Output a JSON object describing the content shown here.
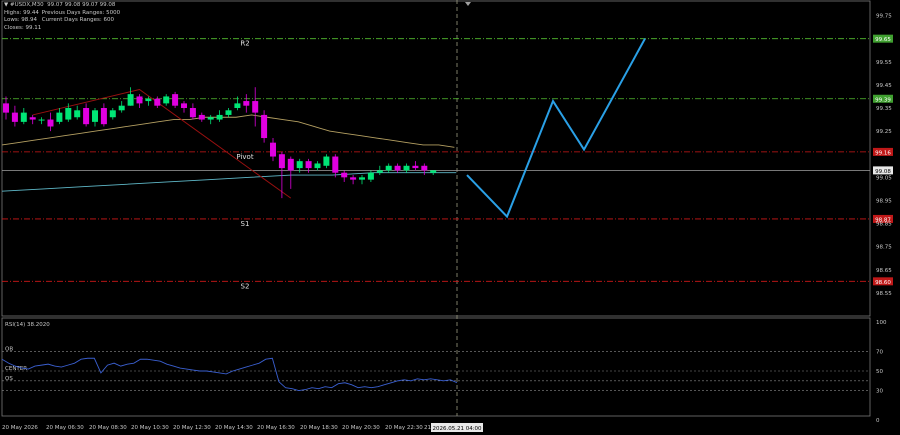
{
  "header": {
    "symbol_line": "▼ #USDX,M30  99.07 99.08 99.07 99.08",
    "highs": "Highs: 99.44",
    "highs_note": "Previous Days Ranges: 5000",
    "lows": "Lows: 98.94",
    "lows_note": "Current Days Ranges: 600",
    "closes": "Closes: 99.11"
  },
  "colors": {
    "background": "#000000",
    "bull": "#00e676",
    "bear": "#e000e0",
    "forecast": "#2aa0e6",
    "ma_slow": "#b5a062",
    "ma_fast": "#5fb8c8",
    "trend_red": "#9a1010",
    "resistance": "#55c030",
    "support": "#d01818",
    "rsi_line": "#3a5fd0",
    "axis_text": "#c8c8c8"
  },
  "chart_data": [
    {
      "type": "candlestick",
      "symbol": "#USDX",
      "timeframe": "M30",
      "ylim": [
        98.45,
        99.8
      ],
      "price_ticks": [
        "99.75",
        "99.65",
        "99.55",
        "99.45",
        "99.39",
        "99.35",
        "99.25",
        "99.16",
        "99.08",
        "99.05",
        "98.95",
        "98.85",
        "98.75",
        "98.65",
        "98.55"
      ],
      "time_labels": [
        "20 May 2026",
        "20 May 06:30",
        "20 May 08:30",
        "20 May 10:30",
        "20 May 12:30",
        "20 May 14:30",
        "20 May 16:30",
        "20 May 18:30",
        "20 May 20:30",
        "20 May 22:30",
        "21"
      ],
      "current_time_label": "2026.05.21 04:00",
      "current_price": "99.08",
      "candles": [
        {
          "o": 99.37,
          "h": 99.4,
          "c": 99.33,
          "l": 99.3
        },
        {
          "o": 99.33,
          "h": 99.36,
          "c": 99.29,
          "l": 99.27
        },
        {
          "o": 99.29,
          "h": 99.35,
          "c": 99.33,
          "l": 99.28
        },
        {
          "o": 99.31,
          "h": 99.32,
          "c": 99.3,
          "l": 99.28
        },
        {
          "o": 99.3,
          "h": 99.31,
          "c": 99.3,
          "l": 99.28
        },
        {
          "o": 99.3,
          "h": 99.33,
          "c": 99.27,
          "l": 99.25
        },
        {
          "o": 99.29,
          "h": 99.35,
          "c": 99.33,
          "l": 99.28
        },
        {
          "o": 99.3,
          "h": 99.37,
          "c": 99.35,
          "l": 99.29
        },
        {
          "o": 99.31,
          "h": 99.36,
          "c": 99.34,
          "l": 99.3
        },
        {
          "o": 99.35,
          "h": 99.37,
          "c": 99.28,
          "l": 99.27
        },
        {
          "o": 99.29,
          "h": 99.35,
          "c": 99.34,
          "l": 99.27
        },
        {
          "o": 99.35,
          "h": 99.37,
          "c": 99.28,
          "l": 99.27
        },
        {
          "o": 99.31,
          "h": 99.35,
          "c": 99.34,
          "l": 99.3
        },
        {
          "o": 99.34,
          "h": 99.38,
          "c": 99.36,
          "l": 99.33
        },
        {
          "o": 99.36,
          "h": 99.44,
          "c": 99.41,
          "l": 99.36
        },
        {
          "o": 99.4,
          "h": 99.41,
          "c": 99.37,
          "l": 99.35
        },
        {
          "o": 99.38,
          "h": 99.4,
          "c": 99.39,
          "l": 99.36
        },
        {
          "o": 99.39,
          "h": 99.4,
          "c": 99.36,
          "l": 99.35
        },
        {
          "o": 99.37,
          "h": 99.41,
          "c": 99.4,
          "l": 99.36
        },
        {
          "o": 99.41,
          "h": 99.42,
          "c": 99.36,
          "l": 99.35
        },
        {
          "o": 99.37,
          "h": 99.38,
          "c": 99.35,
          "l": 99.33
        },
        {
          "o": 99.35,
          "h": 99.37,
          "c": 99.31,
          "l": 99.3
        },
        {
          "o": 99.32,
          "h": 99.33,
          "c": 99.3,
          "l": 99.29
        },
        {
          "o": 99.3,
          "h": 99.32,
          "c": 99.31,
          "l": 99.28
        },
        {
          "o": 99.3,
          "h": 99.34,
          "c": 99.32,
          "l": 99.29
        },
        {
          "o": 99.32,
          "h": 99.35,
          "c": 99.34,
          "l": 99.31
        },
        {
          "o": 99.35,
          "h": 99.4,
          "c": 99.37,
          "l": 99.34
        },
        {
          "o": 99.38,
          "h": 99.41,
          "c": 99.36,
          "l": 99.33
        },
        {
          "o": 99.38,
          "h": 99.44,
          "c": 99.33,
          "l": 99.27
        },
        {
          "o": 99.32,
          "h": 99.34,
          "c": 99.22,
          "l": 99.2
        },
        {
          "o": 99.2,
          "h": 99.22,
          "c": 99.14,
          "l": 99.12
        },
        {
          "o": 99.15,
          "h": 99.16,
          "c": 99.09,
          "l": 98.96
        },
        {
          "o": 99.13,
          "h": 99.14,
          "c": 99.08,
          "l": 99.0
        },
        {
          "o": 99.09,
          "h": 99.13,
          "c": 99.12,
          "l": 99.07
        },
        {
          "o": 99.12,
          "h": 99.13,
          "c": 99.09,
          "l": 99.07
        },
        {
          "o": 99.09,
          "h": 99.12,
          "c": 99.11,
          "l": 99.08
        },
        {
          "o": 99.1,
          "h": 99.15,
          "c": 99.14,
          "l": 99.09
        },
        {
          "o": 99.14,
          "h": 99.15,
          "c": 99.07,
          "l": 99.05
        },
        {
          "o": 99.07,
          "h": 99.08,
          "c": 99.05,
          "l": 99.03
        },
        {
          "o": 99.05,
          "h": 99.06,
          "c": 99.04,
          "l": 99.02
        },
        {
          "o": 99.04,
          "h": 99.06,
          "c": 99.05,
          "l": 99.02
        },
        {
          "o": 99.04,
          "h": 99.08,
          "c": 99.07,
          "l": 99.03
        },
        {
          "o": 99.07,
          "h": 99.1,
          "c": 99.08,
          "l": 99.06
        },
        {
          "o": 99.08,
          "h": 99.11,
          "c": 99.1,
          "l": 99.07
        },
        {
          "o": 99.1,
          "h": 99.11,
          "c": 99.08,
          "l": 99.07
        },
        {
          "o": 99.08,
          "h": 99.11,
          "c": 99.1,
          "l": 99.07
        },
        {
          "o": 99.1,
          "h": 99.12,
          "c": 99.09,
          "l": 99.08
        },
        {
          "o": 99.1,
          "h": 99.11,
          "c": 99.08,
          "l": 99.06
        },
        {
          "o": 99.07,
          "h": 99.08,
          "c": 99.08,
          "l": 99.06
        }
      ],
      "ma_slow": [
        99.19,
        99.2,
        99.21,
        99.22,
        99.23,
        99.24,
        99.25,
        99.26,
        99.27,
        99.28,
        99.29,
        99.3,
        99.3,
        99.31,
        99.31,
        99.31,
        99.32,
        99.31,
        99.3,
        99.29,
        99.27,
        99.25,
        99.24,
        99.23,
        99.22,
        99.21,
        99.2,
        99.19,
        99.19,
        99.18
      ],
      "ma_fast": [
        98.99,
        99.0,
        99.01,
        99.02,
        99.03,
        99.04,
        99.05,
        99.06,
        99.06,
        99.07,
        99.07,
        99.07
      ],
      "trend_line": [
        99.32,
        99.43,
        98.96
      ],
      "levels": [
        {
          "label": "R2",
          "value": 99.65,
          "price_tag": "99.65",
          "kind": "resistance"
        },
        {
          "label": "",
          "value": 99.39,
          "price_tag": "99.39",
          "kind": "resistance"
        },
        {
          "label": "Pivot",
          "value": 99.16,
          "price_tag": "99.16",
          "kind": "pivot"
        },
        {
          "label": "S1",
          "value": 98.87,
          "price_tag": "98.87",
          "kind": "support"
        },
        {
          "label": "S2",
          "value": 98.6,
          "price_tag": "98.60",
          "kind": "support"
        }
      ],
      "forecast_path": [
        99.06,
        98.88,
        99.38,
        99.17,
        99.65
      ]
    },
    {
      "type": "line",
      "title": "RSI(14) 38.2020",
      "ylim": [
        0,
        100
      ],
      "y_ticks": [
        "100",
        "70",
        "50",
        "30",
        "0"
      ],
      "levels": [
        {
          "label": "OB",
          "value": 70
        },
        {
          "label": "CENTER",
          "value": 50
        },
        {
          "label": "OS",
          "value": 40
        },
        {
          "label": "",
          "value": 30
        }
      ],
      "values": [
        62,
        58,
        55,
        53,
        52,
        55,
        56,
        57,
        55,
        54,
        56,
        58,
        62,
        63,
        63,
        48,
        56,
        58,
        55,
        57,
        58,
        62,
        62,
        61,
        60,
        57,
        55,
        53,
        52,
        51,
        50,
        50,
        49,
        48,
        47,
        50,
        52,
        54,
        56,
        58,
        62,
        63,
        39,
        33,
        32,
        30,
        31,
        33,
        32,
        34,
        33,
        37,
        38,
        36,
        33,
        34,
        33,
        34,
        36,
        38,
        40,
        41,
        40,
        42,
        41,
        42,
        41,
        40,
        41,
        38
      ]
    }
  ]
}
